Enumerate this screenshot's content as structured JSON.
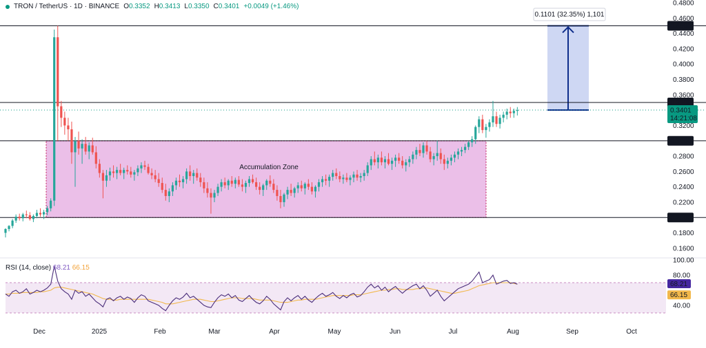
{
  "header": {
    "symbol": "TRON / TetherUS · 1D · BINANCE",
    "o_label": "O",
    "o": "0.3352",
    "h_label": "H",
    "h": "0.3413",
    "l_label": "L",
    "l": "0.3350",
    "c_label": "C",
    "c": "0.3401",
    "change": "+0.0049 (+1.46%)"
  },
  "rsi": {
    "label": "RSI (14, close)",
    "value": "68.21",
    "ma": "66.15"
  },
  "colors": {
    "up": "#26a69a",
    "down": "#ef5350",
    "zone_fill": "#e8b4e4",
    "zone_border": "#c2185b",
    "target_fill": "#c9d3f2",
    "arrow": "#0d2c8a",
    "rsi_line": "#4a2d7a",
    "rsi_ma": "#f2b84b",
    "rsi_band": "#f3e8f5",
    "price_label_bg": "#089981"
  },
  "chart_data": [
    {
      "type": "candlestick",
      "title": "TRON / TetherUS · 1D · BINANCE",
      "x_ticks": [
        "Dec",
        "2025",
        "Feb",
        "Mar",
        "Apr",
        "May",
        "Jun",
        "Jul",
        "Aug",
        "Sep",
        "Oct"
      ],
      "y_ticks": [
        "0.4800",
        "0.4600",
        "0.4400",
        "0.4200",
        "0.4000",
        "0.3800",
        "0.3600",
        "0.3200",
        "0.2800",
        "0.2600",
        "0.2400",
        "0.2200",
        "0.1800",
        "0.1600"
      ],
      "ylim": [
        0.15,
        0.48
      ],
      "horizontal_levels": [
        {
          "value": 0.45,
          "label": "0.4500"
        },
        {
          "value": 0.35,
          "label": "0.3500"
        },
        {
          "value": 0.3,
          "label": "0.3000"
        },
        {
          "value": 0.2,
          "label": "0.2000"
        }
      ],
      "current_price": {
        "value": 0.3401,
        "label": "0.3401",
        "countdown": "14:21:08"
      },
      "annotations": [
        {
          "text": "Accumulation Zone",
          "range_low": 0.2,
          "range_high": 0.3,
          "from": "Dec",
          "to": "Jul"
        },
        {
          "text": "0.1101 (32.35%) 1,101",
          "from_price": 0.3401,
          "to_price": 0.45
        }
      ],
      "ohlc": [
        [
          0.18,
          0.186,
          0.174,
          0.185
        ],
        [
          0.185,
          0.19,
          0.182,
          0.189
        ],
        [
          0.189,
          0.198,
          0.186,
          0.196
        ],
        [
          0.196,
          0.204,
          0.193,
          0.201
        ],
        [
          0.201,
          0.205,
          0.196,
          0.199
        ],
        [
          0.199,
          0.206,
          0.195,
          0.204
        ],
        [
          0.204,
          0.209,
          0.199,
          0.203
        ],
        [
          0.203,
          0.207,
          0.196,
          0.198
        ],
        [
          0.198,
          0.204,
          0.194,
          0.202
        ],
        [
          0.202,
          0.21,
          0.199,
          0.206
        ],
        [
          0.206,
          0.212,
          0.201,
          0.204
        ],
        [
          0.204,
          0.21,
          0.198,
          0.207
        ],
        [
          0.207,
          0.215,
          0.203,
          0.212
        ],
        [
          0.212,
          0.225,
          0.208,
          0.222
        ],
        [
          0.222,
          0.445,
          0.215,
          0.435
        ],
        [
          0.435,
          0.45,
          0.3,
          0.345
        ],
        [
          0.345,
          0.352,
          0.318,
          0.33
        ],
        [
          0.33,
          0.338,
          0.308,
          0.32
        ],
        [
          0.32,
          0.33,
          0.3,
          0.315
        ],
        [
          0.315,
          0.325,
          0.27,
          0.285
        ],
        [
          0.285,
          0.305,
          0.24,
          0.3
        ],
        [
          0.3,
          0.312,
          0.282,
          0.29
        ],
        [
          0.29,
          0.302,
          0.27,
          0.296
        ],
        [
          0.296,
          0.305,
          0.282,
          0.286
        ],
        [
          0.286,
          0.298,
          0.276,
          0.294
        ],
        [
          0.294,
          0.304,
          0.282,
          0.285
        ],
        [
          0.285,
          0.293,
          0.264,
          0.27
        ],
        [
          0.27,
          0.276,
          0.252,
          0.258
        ],
        [
          0.258,
          0.262,
          0.225,
          0.248
        ],
        [
          0.248,
          0.262,
          0.24,
          0.255
        ],
        [
          0.255,
          0.265,
          0.248,
          0.26
        ],
        [
          0.26,
          0.268,
          0.252,
          0.258
        ],
        [
          0.258,
          0.266,
          0.25,
          0.262
        ],
        [
          0.262,
          0.27,
          0.255,
          0.258
        ],
        [
          0.258,
          0.265,
          0.25,
          0.262
        ],
        [
          0.262,
          0.268,
          0.256,
          0.26
        ],
        [
          0.26,
          0.266,
          0.252,
          0.256
        ],
        [
          0.256,
          0.262,
          0.248,
          0.259
        ],
        [
          0.259,
          0.268,
          0.254,
          0.264
        ],
        [
          0.264,
          0.272,
          0.258,
          0.268
        ],
        [
          0.268,
          0.274,
          0.262,
          0.266
        ],
        [
          0.266,
          0.27,
          0.256,
          0.258
        ],
        [
          0.258,
          0.264,
          0.25,
          0.255
        ],
        [
          0.255,
          0.262,
          0.246,
          0.25
        ],
        [
          0.25,
          0.258,
          0.24,
          0.245
        ],
        [
          0.245,
          0.252,
          0.232,
          0.236
        ],
        [
          0.236,
          0.244,
          0.222,
          0.228
        ],
        [
          0.228,
          0.238,
          0.22,
          0.234
        ],
        [
          0.234,
          0.246,
          0.228,
          0.242
        ],
        [
          0.242,
          0.252,
          0.236,
          0.248
        ],
        [
          0.248,
          0.256,
          0.24,
          0.246
        ],
        [
          0.246,
          0.254,
          0.238,
          0.25
        ],
        [
          0.25,
          0.264,
          0.244,
          0.26
        ],
        [
          0.26,
          0.268,
          0.248,
          0.254
        ],
        [
          0.254,
          0.262,
          0.244,
          0.258
        ],
        [
          0.258,
          0.264,
          0.248,
          0.252
        ],
        [
          0.252,
          0.258,
          0.24,
          0.246
        ],
        [
          0.246,
          0.252,
          0.232,
          0.238
        ],
        [
          0.238,
          0.246,
          0.226,
          0.232
        ],
        [
          0.232,
          0.238,
          0.205,
          0.226
        ],
        [
          0.226,
          0.236,
          0.22,
          0.232
        ],
        [
          0.232,
          0.244,
          0.228,
          0.24
        ],
        [
          0.24,
          0.25,
          0.234,
          0.246
        ],
        [
          0.246,
          0.252,
          0.238,
          0.242
        ],
        [
          0.242,
          0.25,
          0.236,
          0.248
        ],
        [
          0.248,
          0.254,
          0.24,
          0.244
        ],
        [
          0.244,
          0.252,
          0.238,
          0.249
        ],
        [
          0.249,
          0.254,
          0.24,
          0.243
        ],
        [
          0.243,
          0.25,
          0.234,
          0.24
        ],
        [
          0.24,
          0.248,
          0.232,
          0.245
        ],
        [
          0.245,
          0.254,
          0.24,
          0.25
        ],
        [
          0.25,
          0.256,
          0.244,
          0.246
        ],
        [
          0.246,
          0.252,
          0.236,
          0.24
        ],
        [
          0.24,
          0.246,
          0.23,
          0.236
        ],
        [
          0.236,
          0.244,
          0.228,
          0.242
        ],
        [
          0.242,
          0.25,
          0.236,
          0.248
        ],
        [
          0.248,
          0.255,
          0.24,
          0.244
        ],
        [
          0.244,
          0.25,
          0.232,
          0.236
        ],
        [
          0.236,
          0.242,
          0.222,
          0.228
        ],
        [
          0.228,
          0.236,
          0.212,
          0.22
        ],
        [
          0.22,
          0.232,
          0.214,
          0.23
        ],
        [
          0.23,
          0.24,
          0.224,
          0.236
        ],
        [
          0.236,
          0.244,
          0.228,
          0.232
        ],
        [
          0.232,
          0.24,
          0.226,
          0.238
        ],
        [
          0.238,
          0.246,
          0.232,
          0.242
        ],
        [
          0.242,
          0.248,
          0.234,
          0.238
        ],
        [
          0.238,
          0.246,
          0.23,
          0.244
        ],
        [
          0.244,
          0.25,
          0.236,
          0.24
        ],
        [
          0.24,
          0.246,
          0.23,
          0.234
        ],
        [
          0.234,
          0.242,
          0.226,
          0.24
        ],
        [
          0.24,
          0.25,
          0.234,
          0.246
        ],
        [
          0.246,
          0.254,
          0.24,
          0.25
        ],
        [
          0.25,
          0.256,
          0.242,
          0.248
        ],
        [
          0.248,
          0.256,
          0.24,
          0.253
        ],
        [
          0.253,
          0.262,
          0.248,
          0.258
        ],
        [
          0.258,
          0.264,
          0.25,
          0.254
        ],
        [
          0.254,
          0.26,
          0.246,
          0.25
        ],
        [
          0.25,
          0.256,
          0.244,
          0.252
        ],
        [
          0.252,
          0.258,
          0.246,
          0.249
        ],
        [
          0.249,
          0.255,
          0.242,
          0.252
        ],
        [
          0.252,
          0.26,
          0.246,
          0.256
        ],
        [
          0.256,
          0.262,
          0.248,
          0.252
        ],
        [
          0.252,
          0.258,
          0.246,
          0.254
        ],
        [
          0.254,
          0.262,
          0.248,
          0.258
        ],
        [
          0.258,
          0.272,
          0.254,
          0.268
        ],
        [
          0.268,
          0.28,
          0.262,
          0.276
        ],
        [
          0.276,
          0.286,
          0.268,
          0.272
        ],
        [
          0.272,
          0.282,
          0.264,
          0.278
        ],
        [
          0.278,
          0.286,
          0.268,
          0.272
        ],
        [
          0.272,
          0.28,
          0.264,
          0.276
        ],
        [
          0.276,
          0.284,
          0.268,
          0.27
        ],
        [
          0.27,
          0.278,
          0.262,
          0.274
        ],
        [
          0.274,
          0.282,
          0.266,
          0.278
        ],
        [
          0.278,
          0.284,
          0.27,
          0.274
        ],
        [
          0.274,
          0.28,
          0.264,
          0.268
        ],
        [
          0.268,
          0.276,
          0.26,
          0.272
        ],
        [
          0.272,
          0.28,
          0.266,
          0.276
        ],
        [
          0.276,
          0.286,
          0.27,
          0.282
        ],
        [
          0.282,
          0.292,
          0.276,
          0.288
        ],
        [
          0.288,
          0.296,
          0.28,
          0.284
        ],
        [
          0.284,
          0.298,
          0.278,
          0.294
        ],
        [
          0.294,
          0.3,
          0.282,
          0.286
        ],
        [
          0.286,
          0.292,
          0.272,
          0.276
        ],
        [
          0.276,
          0.284,
          0.268,
          0.28
        ],
        [
          0.28,
          0.3,
          0.274,
          0.284
        ],
        [
          0.284,
          0.29,
          0.27,
          0.276
        ],
        [
          0.276,
          0.282,
          0.262,
          0.27
        ],
        [
          0.27,
          0.278,
          0.264,
          0.274
        ],
        [
          0.274,
          0.282,
          0.268,
          0.278
        ],
        [
          0.278,
          0.286,
          0.272,
          0.282
        ],
        [
          0.282,
          0.29,
          0.276,
          0.286
        ],
        [
          0.286,
          0.292,
          0.28,
          0.288
        ],
        [
          0.288,
          0.296,
          0.284,
          0.292
        ],
        [
          0.292,
          0.3,
          0.288,
          0.298
        ],
        [
          0.298,
          0.306,
          0.292,
          0.302
        ],
        [
          0.302,
          0.32,
          0.296,
          0.318
        ],
        [
          0.318,
          0.332,
          0.31,
          0.328
        ],
        [
          0.328,
          0.334,
          0.31,
          0.314
        ],
        [
          0.314,
          0.322,
          0.304,
          0.318
        ],
        [
          0.318,
          0.328,
          0.312,
          0.324
        ],
        [
          0.324,
          0.352,
          0.318,
          0.332
        ],
        [
          0.332,
          0.338,
          0.318,
          0.322
        ],
        [
          0.322,
          0.334,
          0.316,
          0.33
        ],
        [
          0.33,
          0.338,
          0.324,
          0.334
        ],
        [
          0.334,
          0.342,
          0.328,
          0.338
        ],
        [
          0.338,
          0.344,
          0.33,
          0.336
        ],
        [
          0.336,
          0.342,
          0.33,
          0.339
        ],
        [
          0.339,
          0.344,
          0.333,
          0.34
        ]
      ],
      "rsi_ticks": [
        "100.00",
        "80.00",
        "40.00"
      ],
      "rsi_ylim": [
        20,
        100
      ],
      "rsi_bands": [
        70,
        30
      ],
      "rsi_values": [
        55,
        52,
        58,
        60,
        56,
        58,
        62,
        55,
        57,
        60,
        58,
        60,
        63,
        68,
        92,
        72,
        62,
        58,
        55,
        48,
        60,
        56,
        58,
        52,
        55,
        50,
        45,
        42,
        38,
        48,
        50,
        46,
        50,
        52,
        48,
        51,
        49,
        44,
        50,
        54,
        52,
        46,
        44,
        42,
        40,
        36,
        33,
        40,
        46,
        50,
        48,
        51,
        56,
        50,
        52,
        48,
        44,
        40,
        38,
        37,
        44,
        50,
        54,
        52,
        55,
        50,
        53,
        47,
        45,
        49,
        53,
        48,
        44,
        42,
        46,
        52,
        48,
        42,
        38,
        34,
        45,
        50,
        46,
        50,
        53,
        48,
        52,
        47,
        44,
        49,
        53,
        56,
        52,
        54,
        57,
        52,
        49,
        53,
        50,
        54,
        56,
        51,
        53,
        58,
        64,
        68,
        63,
        66,
        60,
        64,
        58,
        62,
        65,
        60,
        56,
        60,
        63,
        66,
        68,
        62,
        66,
        60,
        52,
        56,
        60,
        52,
        46,
        50,
        54,
        58,
        62,
        64,
        66,
        68,
        72,
        78,
        84,
        70,
        72,
        74,
        80,
        68,
        70,
        72,
        73,
        69,
        70,
        68
      ],
      "rsi_ma_values": [
        55,
        55,
        56,
        56,
        56,
        57,
        57,
        57,
        57,
        57,
        58,
        58,
        59,
        60,
        63,
        64,
        64,
        63,
        62,
        61,
        60,
        59,
        58,
        57,
        56,
        55,
        53,
        51,
        49,
        48,
        48,
        47,
        47,
        48,
        48,
        48,
        48,
        48,
        48,
        48,
        48,
        48,
        47,
        46,
        45,
        44,
        42,
        42,
        42,
        43,
        44,
        45,
        46,
        47,
        48,
        48,
        48,
        47,
        46,
        45,
        45,
        46,
        47,
        48,
        49,
        50,
        50,
        50,
        49,
        49,
        49,
        49,
        48,
        47,
        47,
        47,
        47,
        46,
        45,
        44,
        44,
        44,
        45,
        46,
        47,
        47,
        48,
        48,
        48,
        48,
        49,
        50,
        51,
        52,
        53,
        53,
        53,
        53,
        53,
        53,
        54,
        54,
        54,
        55,
        56,
        57,
        58,
        59,
        60,
        60,
        61,
        61,
        62,
        62,
        61,
        61,
        61,
        61,
        62,
        62,
        63,
        63,
        62,
        61,
        60,
        59,
        58,
        57,
        56,
        56,
        57,
        58,
        59,
        60,
        62,
        64,
        66,
        67,
        68,
        69,
        70,
        70,
        70,
        70,
        70,
        70,
        69,
        68
      ]
    }
  ]
}
